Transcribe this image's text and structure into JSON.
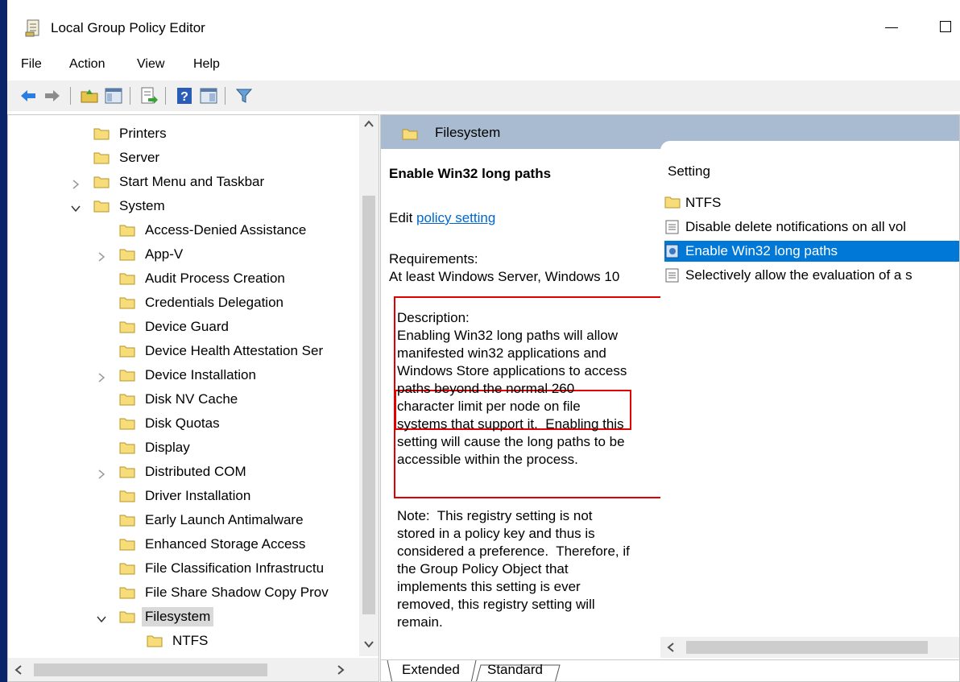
{
  "window": {
    "title": "Local Group Policy Editor"
  },
  "menu": [
    "File",
    "Action",
    "View",
    "Help"
  ],
  "toolbar": {
    "buttons": [
      "back-icon",
      "forward-icon",
      "up-folder-icon",
      "show-hide-tree-icon",
      "export-list-icon",
      "help-icon",
      "console-view-icon",
      "filter-icon"
    ]
  },
  "tree": {
    "items": [
      {
        "label": "Printers",
        "indent": 1,
        "expander": ""
      },
      {
        "label": "Server",
        "indent": 1,
        "expander": ""
      },
      {
        "label": "Start Menu and Taskbar",
        "indent": 1,
        "expander": "collapsed"
      },
      {
        "label": "System",
        "indent": 1,
        "expander": "expanded"
      },
      {
        "label": "Access-Denied Assistance",
        "indent": 2,
        "expander": ""
      },
      {
        "label": "App-V",
        "indent": 2,
        "expander": "collapsed"
      },
      {
        "label": "Audit Process Creation",
        "indent": 2,
        "expander": ""
      },
      {
        "label": "Credentials Delegation",
        "indent": 2,
        "expander": ""
      },
      {
        "label": "Device Guard",
        "indent": 2,
        "expander": ""
      },
      {
        "label": "Device Health Attestation Ser",
        "indent": 2,
        "expander": ""
      },
      {
        "label": "Device Installation",
        "indent": 2,
        "expander": "collapsed"
      },
      {
        "label": "Disk NV Cache",
        "indent": 2,
        "expander": ""
      },
      {
        "label": "Disk Quotas",
        "indent": 2,
        "expander": ""
      },
      {
        "label": "Display",
        "indent": 2,
        "expander": ""
      },
      {
        "label": "Distributed COM",
        "indent": 2,
        "expander": "collapsed"
      },
      {
        "label": "Driver Installation",
        "indent": 2,
        "expander": ""
      },
      {
        "label": "Early Launch Antimalware",
        "indent": 2,
        "expander": ""
      },
      {
        "label": "Enhanced Storage Access",
        "indent": 2,
        "expander": ""
      },
      {
        "label": "File Classification Infrastructu",
        "indent": 2,
        "expander": ""
      },
      {
        "label": "File Share Shadow Copy Prov",
        "indent": 2,
        "expander": ""
      },
      {
        "label": "Filesystem",
        "indent": 2,
        "expander": "expanded",
        "selected": true
      },
      {
        "label": "NTFS",
        "indent": 3,
        "expander": ""
      }
    ]
  },
  "right": {
    "header": "Filesystem",
    "policy_title": "Enable Win32 long paths",
    "edit_prefix": "Edit ",
    "edit_link": "policy setting",
    "requirements_label": "Requirements:",
    "requirements_text": "At least Windows Server, Windows 10",
    "description_label": "Description:",
    "description_lines": [
      "Enabling Win32 long paths will allow",
      "manifested win32 applications and",
      "Windows Store applications to access",
      "paths beyond the normal 260",
      "character limit per node on file",
      "systems that support it.  Enabling this",
      "setting will cause the long paths to be",
      "accessible within the process."
    ],
    "note_lines": [
      "Note:  This registry setting is not",
      "stored in a policy key and thus is",
      "considered a preference.  Therefore, if",
      "the Group Policy Object that",
      "implements this setting is ever",
      "removed, this registry setting will",
      "remain."
    ],
    "list_header": "Setting",
    "list_items": [
      {
        "label": "NTFS",
        "icon": "folder-icon"
      },
      {
        "label": "Disable delete notifications on all vol",
        "icon": "policy-setting-icon"
      },
      {
        "label": "Enable Win32 long paths",
        "icon": "policy-setting-icon",
        "selected": true
      },
      {
        "label": "Selectively allow the evaluation of a s",
        "icon": "policy-setting-icon"
      }
    ],
    "tabs": [
      "Extended",
      "Standard"
    ]
  },
  "colors": {
    "header_bg": "#a8bbd0",
    "selection": "#0078d7",
    "highlight_box": "#e00000",
    "link": "#0066cc",
    "left_accent": "#0a246a"
  }
}
